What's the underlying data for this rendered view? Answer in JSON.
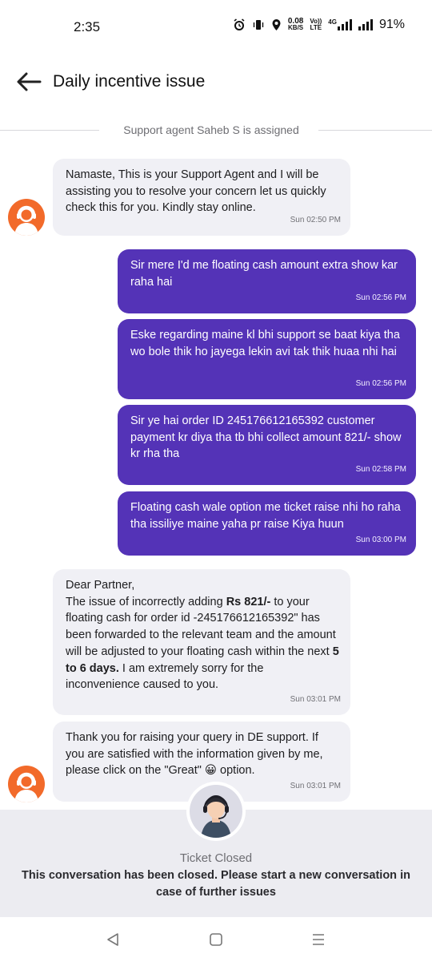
{
  "status_bar": {
    "time": "2:35",
    "net_speed_value": "0.08",
    "net_speed_unit": "KB/S",
    "volte_top": "Vo))",
    "volte_bottom": "LTE",
    "network": "4G",
    "battery": "91%"
  },
  "header": {
    "title": "Daily incentive issue"
  },
  "assignment": {
    "text": "Support agent Saheb S is assigned"
  },
  "messages": [
    {
      "direction": "incoming",
      "text": "Namaste, This is your Support Agent and I will be assisting you to resolve your concern let us quickly check this for you. Kindly stay online.",
      "time": "Sun 02:50 PM"
    },
    {
      "direction": "outgoing",
      "text": "Sir mere I'd me floating cash amount extra show kar raha hai",
      "time": "Sun 02:56 PM"
    },
    {
      "direction": "outgoing",
      "text": "Eske regarding maine kl bhi support se baat kiya tha wo bole thik ho jayega lekin avi tak thik huaa nhi hai",
      "time": "Sun 02:56 PM"
    },
    {
      "direction": "outgoing",
      "text": "Sir ye hai order ID 245176612165392 customer payment kr diya tha tb bhi collect amount 821/- show kr rha tha",
      "time": "Sun 02:58 PM"
    },
    {
      "direction": "outgoing",
      "text": "Floating cash wale option me ticket raise nhi ho raha tha issiliye maine yaha pr raise Kiya huun",
      "time": "Sun 03:00 PM"
    },
    {
      "direction": "incoming",
      "greeting": "Dear Partner,",
      "part1": "The issue of incorrectly adding ",
      "bold1": "Rs 821/-",
      "part2": " to your floating cash for order id -245176612165392\" has been forwarded to the relevant team and the amount will be adjusted to your floating cash within the next ",
      "bold2": "5 to 6 days.",
      "part3": " I am extremely sorry for the inconvenience caused to you.",
      "time": "Sun 03:01 PM"
    },
    {
      "direction": "incoming",
      "text": "Thank you for raising your query in DE support. If you are satisfied with the information given by me, please click on the \"Great\" 😀 option.",
      "time": "Sun 03:01 PM"
    }
  ],
  "closed": {
    "title": "Ticket Closed",
    "message": "This conversation has been closed. Please start a new conversation in case of further issues"
  },
  "colors": {
    "outgoing_bubble": "#5433b7",
    "incoming_bubble": "#f0f0f5",
    "avatar": "#f26a2a",
    "closed_panel": "#ececf1"
  },
  "icons": [
    "back-arrow-icon",
    "alarm-icon",
    "vibrate-icon",
    "location-icon",
    "signal-icon",
    "agent-avatar-icon",
    "nav-back-icon",
    "nav-home-icon",
    "nav-recents-icon"
  ]
}
